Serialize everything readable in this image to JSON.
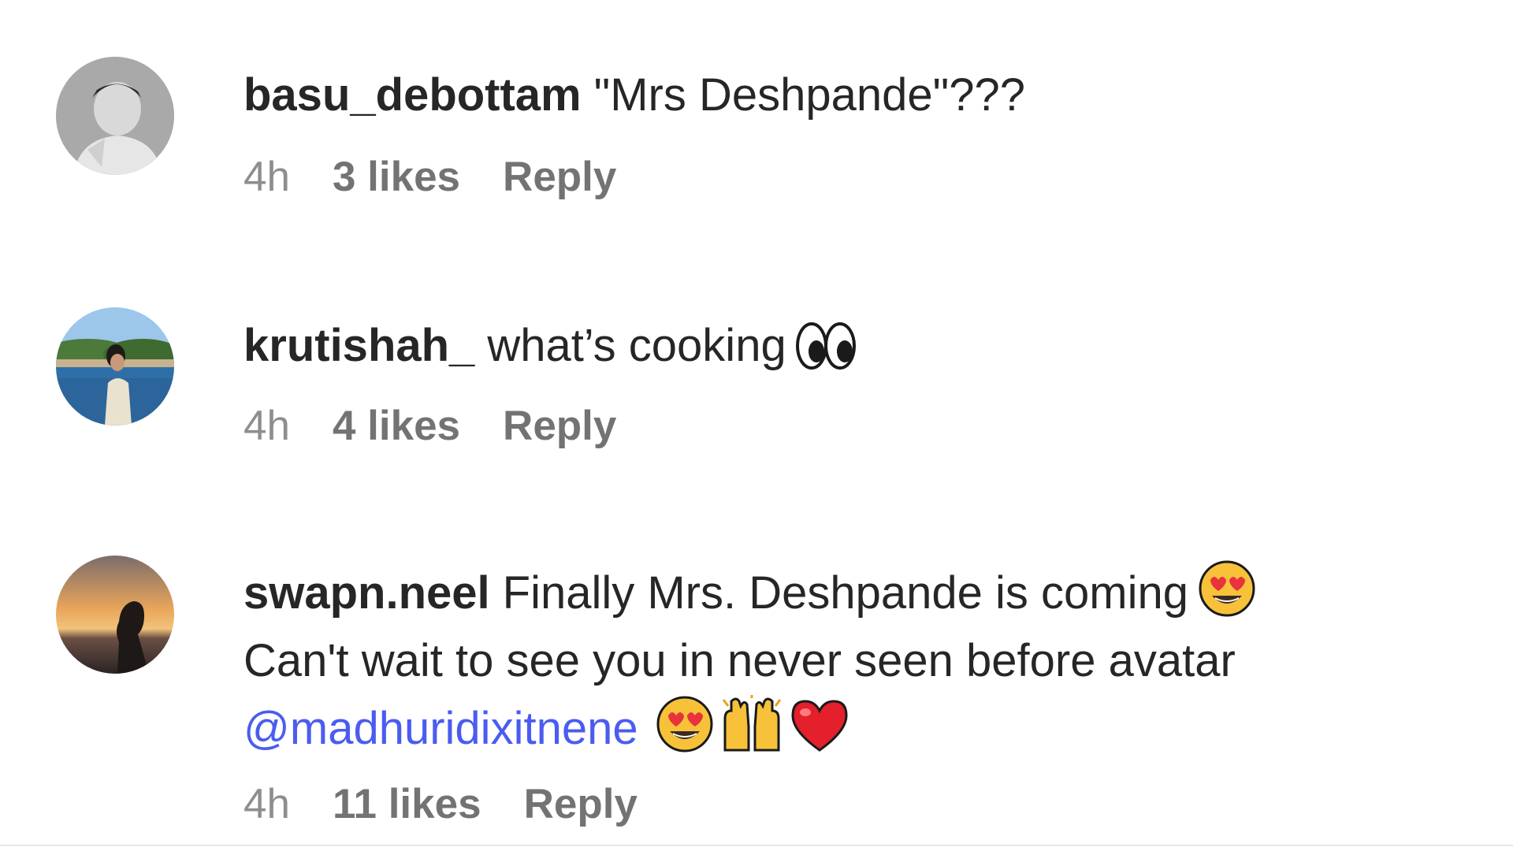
{
  "comments": [
    {
      "username": "basu_debottam",
      "text": "\"Mrs Deshpande\"???",
      "time": "4h",
      "likes": "3 likes",
      "reply_label": "Reply"
    },
    {
      "username": "krutishah_",
      "text": "what’s cooking",
      "time": "4h",
      "likes": "4 likes",
      "reply_label": "Reply"
    },
    {
      "username": "swapn.neel",
      "line1": "Finally Mrs. Deshpande is coming",
      "line2": "Can't wait to see you in never seen before avatar",
      "mention": "@madhuridixitnene",
      "time": "4h",
      "likes": "11 likes",
      "reply_label": "Reply"
    }
  ],
  "colors": {
    "text": "#262626",
    "meta": "#8e8e8e",
    "mention": "#4a5cf0"
  }
}
